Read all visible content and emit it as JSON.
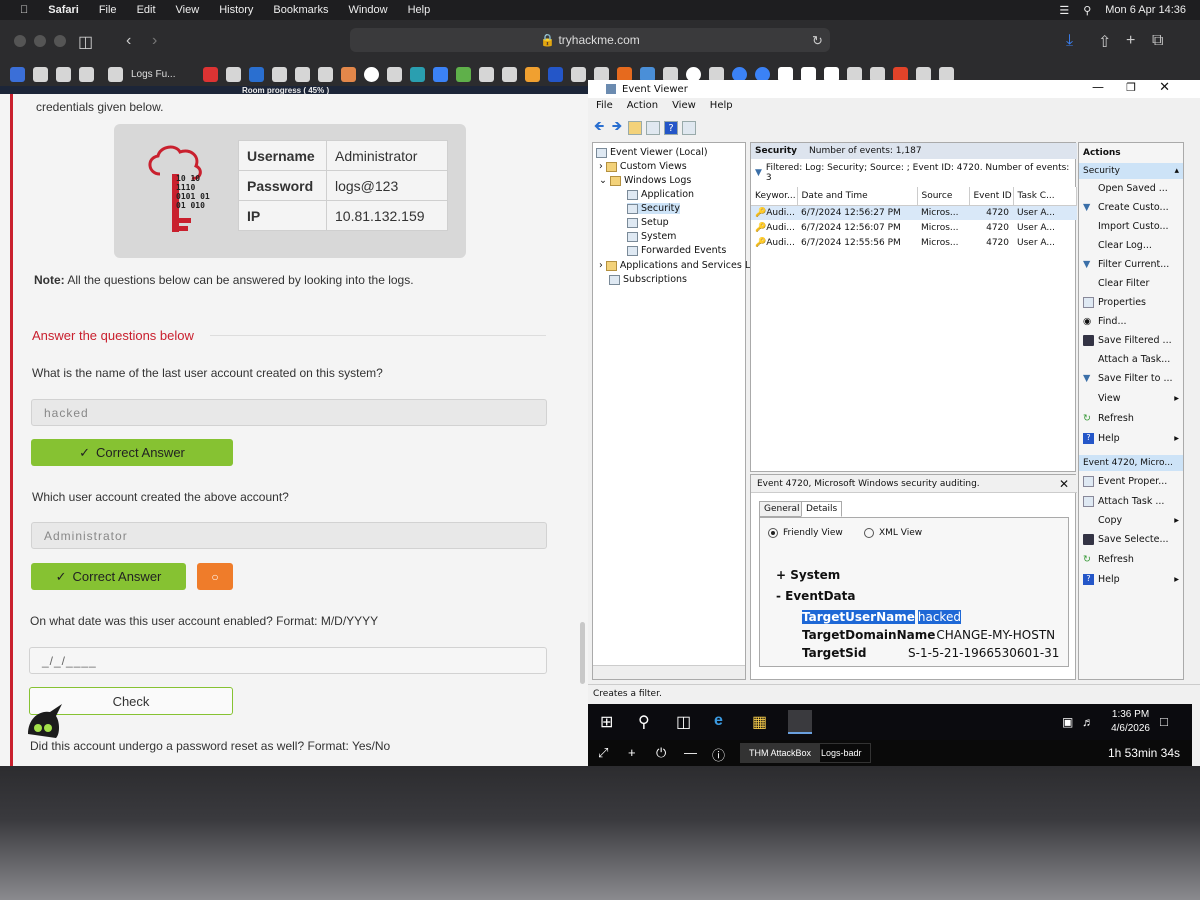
{
  "menubar": {
    "app": "Safari",
    "items": [
      "File",
      "Edit",
      "View",
      "History",
      "Bookmarks",
      "Window",
      "Help"
    ],
    "datetime": "Mon 6 Apr  14:36"
  },
  "safari": {
    "url": "tryhackme.com",
    "tab_label": "Logs Fu..."
  },
  "room": {
    "progress": "Room progress ( 45% )",
    "intro": "credentials given below.",
    "creds": [
      {
        "key": "Username",
        "value": "Administrator"
      },
      {
        "key": "Password",
        "value": "logs@123"
      },
      {
        "key": "IP",
        "value": "10.81.132.159"
      }
    ],
    "logo_text": "10 10\n1110\n0101 01\n01 010",
    "note_bold": "Note:",
    "note": " All the questions below can be answered by looking into the logs.",
    "answer_heading": "Answer the questions below",
    "q1": {
      "question": "What is the name of the last user account created on this system?",
      "answer": "hacked",
      "button": "Correct Answer"
    },
    "q2": {
      "question": "Which user account created the above account?",
      "answer": "Administrator",
      "button": "Correct Answer"
    },
    "q3": {
      "question": "On what date was this user account enabled? Format: M/D/YYYY",
      "placeholder": "_/_/____",
      "button": "Check"
    },
    "q4": {
      "question": "Did this account undergo a password reset as well? Format: Yes/No"
    }
  },
  "event_viewer": {
    "title": "Event Viewer",
    "menu": [
      "File",
      "Action",
      "View",
      "Help"
    ],
    "tree": [
      {
        "label": "Event Viewer (Local)",
        "depth": 0
      },
      {
        "label": "Custom Views",
        "depth": 1
      },
      {
        "label": "Windows Logs",
        "depth": 1
      },
      {
        "label": "Application",
        "depth": 2
      },
      {
        "label": "Security",
        "depth": 2
      },
      {
        "label": "Setup",
        "depth": 2
      },
      {
        "label": "System",
        "depth": 2
      },
      {
        "label": "Forwarded Events",
        "depth": 2
      },
      {
        "label": "Applications and Services Lo",
        "depth": 1
      },
      {
        "label": "Subscriptions",
        "depth": 1
      }
    ],
    "center_title": "Security",
    "center_count": "Number of events: 1,187",
    "filter_text": "Filtered: Log: Security; Source: ; Event ID: 4720. Number of events: 3",
    "columns": [
      "Keywor...",
      "Date and Time",
      "Source",
      "Event ID",
      "Task C..."
    ],
    "rows": [
      [
        "Audi...",
        "6/7/2024 12:56:27 PM",
        "Micros...",
        "4720",
        "User A..."
      ],
      [
        "Audi...",
        "6/7/2024 12:56:07 PM",
        "Micros...",
        "4720",
        "User A..."
      ],
      [
        "Audi...",
        "6/7/2024 12:55:56 PM",
        "Micros...",
        "4720",
        "User A..."
      ]
    ],
    "detail_title": "Event 4720, Microsoft Windows security auditing.",
    "tabs": [
      "General",
      "Details"
    ],
    "views": [
      "Friendly View",
      "XML View"
    ],
    "xml": {
      "system": "+  System",
      "eventdata": "-   EventData",
      "fields": [
        {
          "name": "TargetUserName",
          "value": "hacked"
        },
        {
          "name": "TargetDomainName",
          "value": "CHANGE-MY-HOSTN"
        },
        {
          "name": "TargetSid",
          "value": "S-1-5-21-1966530601-31"
        }
      ]
    },
    "actions_head": "Actions",
    "actions_section1": "Security",
    "actions1": [
      "Open Saved ...",
      "Create Custo...",
      "Import Custo...",
      "Clear Log...",
      "Filter Current...",
      "Clear Filter",
      "Properties",
      "Find...",
      "Save Filtered ...",
      "Attach a Task...",
      "Save Filter to ...",
      "View",
      "Refresh",
      "Help"
    ],
    "actions_section2": "Event 4720, Micro...",
    "actions2": [
      "Event Proper...",
      "Attach Task ...",
      "Copy",
      "Save Selecte...",
      "Refresh",
      "Help"
    ],
    "status": "Creates a filter."
  },
  "taskbar": {
    "time": "1:36 PM",
    "date": "4/6/2026"
  },
  "remote": {
    "tabs": [
      "THM AttackBox",
      "Logs-badr"
    ],
    "timer": "1h 53min 34s"
  }
}
